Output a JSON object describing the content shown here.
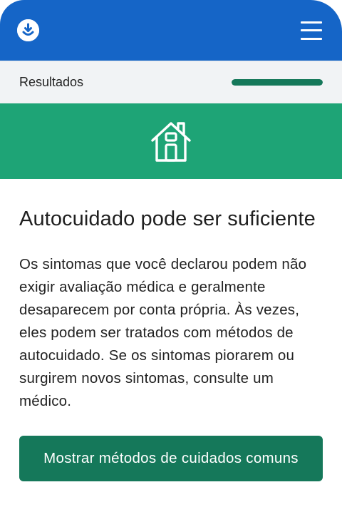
{
  "header": {
    "logo_icon": "support-face-icon",
    "menu_icon": "hamburger-menu-icon",
    "color": "#1565c7"
  },
  "progress": {
    "label": "Resultados",
    "fraction": 1.0,
    "color": "#15785a"
  },
  "banner": {
    "icon": "house-icon",
    "color": "#1ea476"
  },
  "result": {
    "title": "Autocuidado pode ser suficiente",
    "description": "Os sintomas que você declarou podem não exigir avaliação médica e geralmente desaparecem por conta própria. Às vezes, eles podem ser tratados com métodos de autocuidado. Se os sintomas piorarem ou surgirem novos sintomas, consulte um médico."
  },
  "actions": {
    "show_methods_label": "Mostrar métodos de cuidados comuns"
  }
}
